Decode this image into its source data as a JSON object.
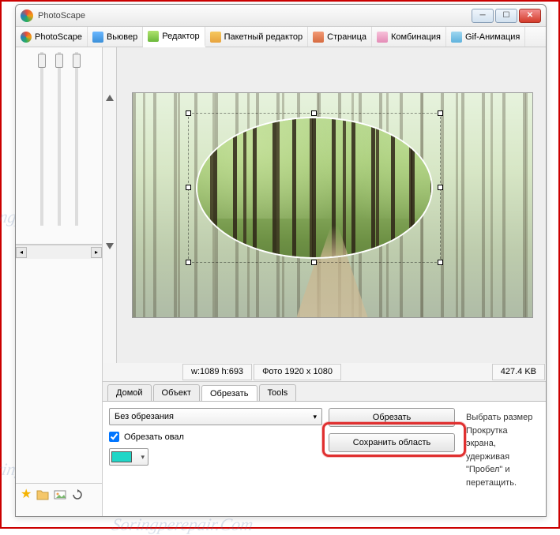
{
  "window": {
    "title": "PhotoScape"
  },
  "toolbar": {
    "tabs": [
      {
        "label": "PhotoScape"
      },
      {
        "label": "Вьювер"
      },
      {
        "label": "Редактор"
      },
      {
        "label": "Пакетный редактор"
      },
      {
        "label": "Страница"
      },
      {
        "label": "Комбинация"
      },
      {
        "label": "Gif-Анимация"
      }
    ]
  },
  "info_bar": {
    "crop_size": "w:1089 h:693",
    "photo_size": "Фото 1920 x 1080",
    "file_size": "427.4 KB"
  },
  "editor_tabs": {
    "items": [
      "Домой",
      "Объект",
      "Обрезать",
      "Tools"
    ]
  },
  "crop_panel": {
    "mode_dropdown": "Без обрезания",
    "oval_checkbox_label": "Обрезать овал",
    "oval_checked": true,
    "swatch_color": "#20d6c7",
    "crop_button": "Обрезать",
    "save_region_button": "Сохранить область",
    "help_line1": "Выбрать размер",
    "help_line2": "Прокрутка экрана, удерживая",
    "help_line3": "\"Пробел\" и перетащить."
  },
  "watermark": "Soringperepair.Com"
}
